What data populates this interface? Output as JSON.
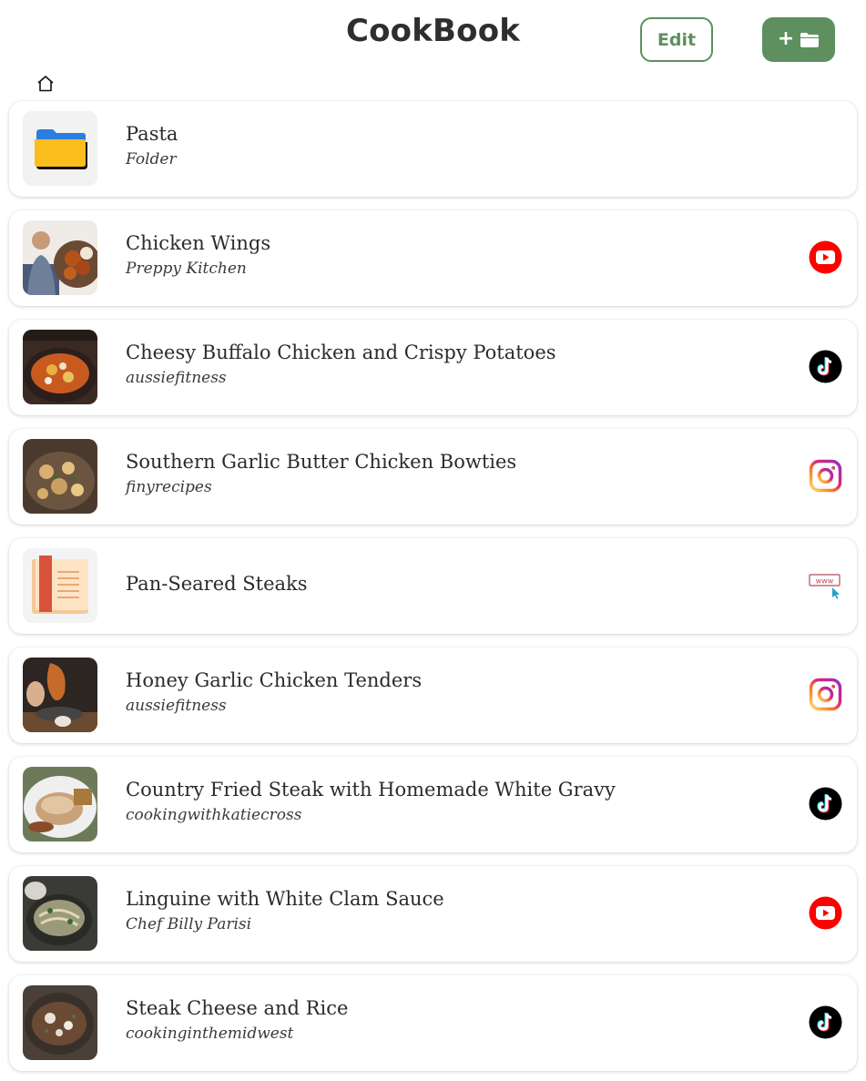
{
  "header": {
    "title": "CookBook",
    "edit_label": "Edit",
    "add_folder_label": "+"
  },
  "colors": {
    "accent_green": "#5e8f5e",
    "youtube_red": "#ff0000",
    "tiktok_black": "#000000"
  },
  "breadcrumb": {
    "icon": "home-icon"
  },
  "items": [
    {
      "title": "Pasta",
      "subtitle": "Folder",
      "thumb": "folder-icon",
      "source": ""
    },
    {
      "title": "Chicken Wings",
      "subtitle": "Preppy Kitchen",
      "thumb": "photo",
      "source": "youtube-icon"
    },
    {
      "title": "Cheesy Buffalo Chicken and Crispy Potatoes",
      "subtitle": "aussiefitness",
      "thumb": "photo",
      "source": "tiktok-icon"
    },
    {
      "title": "Southern Garlic Butter Chicken Bowties",
      "subtitle": "finyrecipes",
      "thumb": "photo",
      "source": "instagram-icon"
    },
    {
      "title": "Pan-Seared Steaks",
      "subtitle": "",
      "thumb": "book-icon",
      "source": "website-icon"
    },
    {
      "title": "Honey Garlic Chicken Tenders",
      "subtitle": "aussiefitness",
      "thumb": "photo",
      "source": "instagram-icon"
    },
    {
      "title": "Country Fried Steak with Homemade White Gravy",
      "subtitle": "cookingwithkatiecross",
      "thumb": "photo",
      "source": "tiktok-icon"
    },
    {
      "title": "Linguine with White Clam Sauce",
      "subtitle": "Chef Billy Parisi",
      "thumb": "photo",
      "source": "youtube-icon"
    },
    {
      "title": "Steak Cheese and Rice",
      "subtitle": "cookinginthemidwest",
      "thumb": "photo",
      "source": "tiktok-icon"
    }
  ]
}
